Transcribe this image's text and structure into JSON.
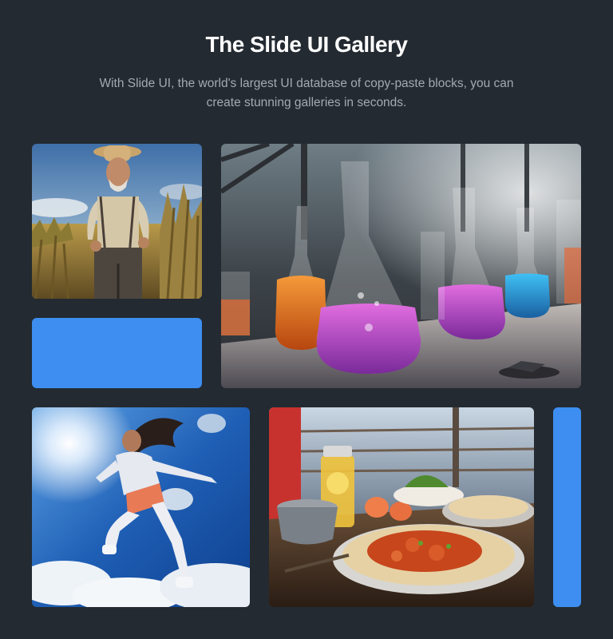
{
  "header": {
    "title": "The Slide UI Gallery",
    "subtitle": "With Slide UI, the world's largest UI database of copy-paste blocks, you can create stunning galleries in seconds."
  },
  "gallery": {
    "accent_color": "#3d8ef0",
    "images": [
      {
        "name": "farmer-in-cornfield"
      },
      {
        "name": "laboratory-flasks"
      },
      {
        "name": "woman-jumping-sky"
      },
      {
        "name": "curry-and-naan-meal"
      }
    ]
  }
}
